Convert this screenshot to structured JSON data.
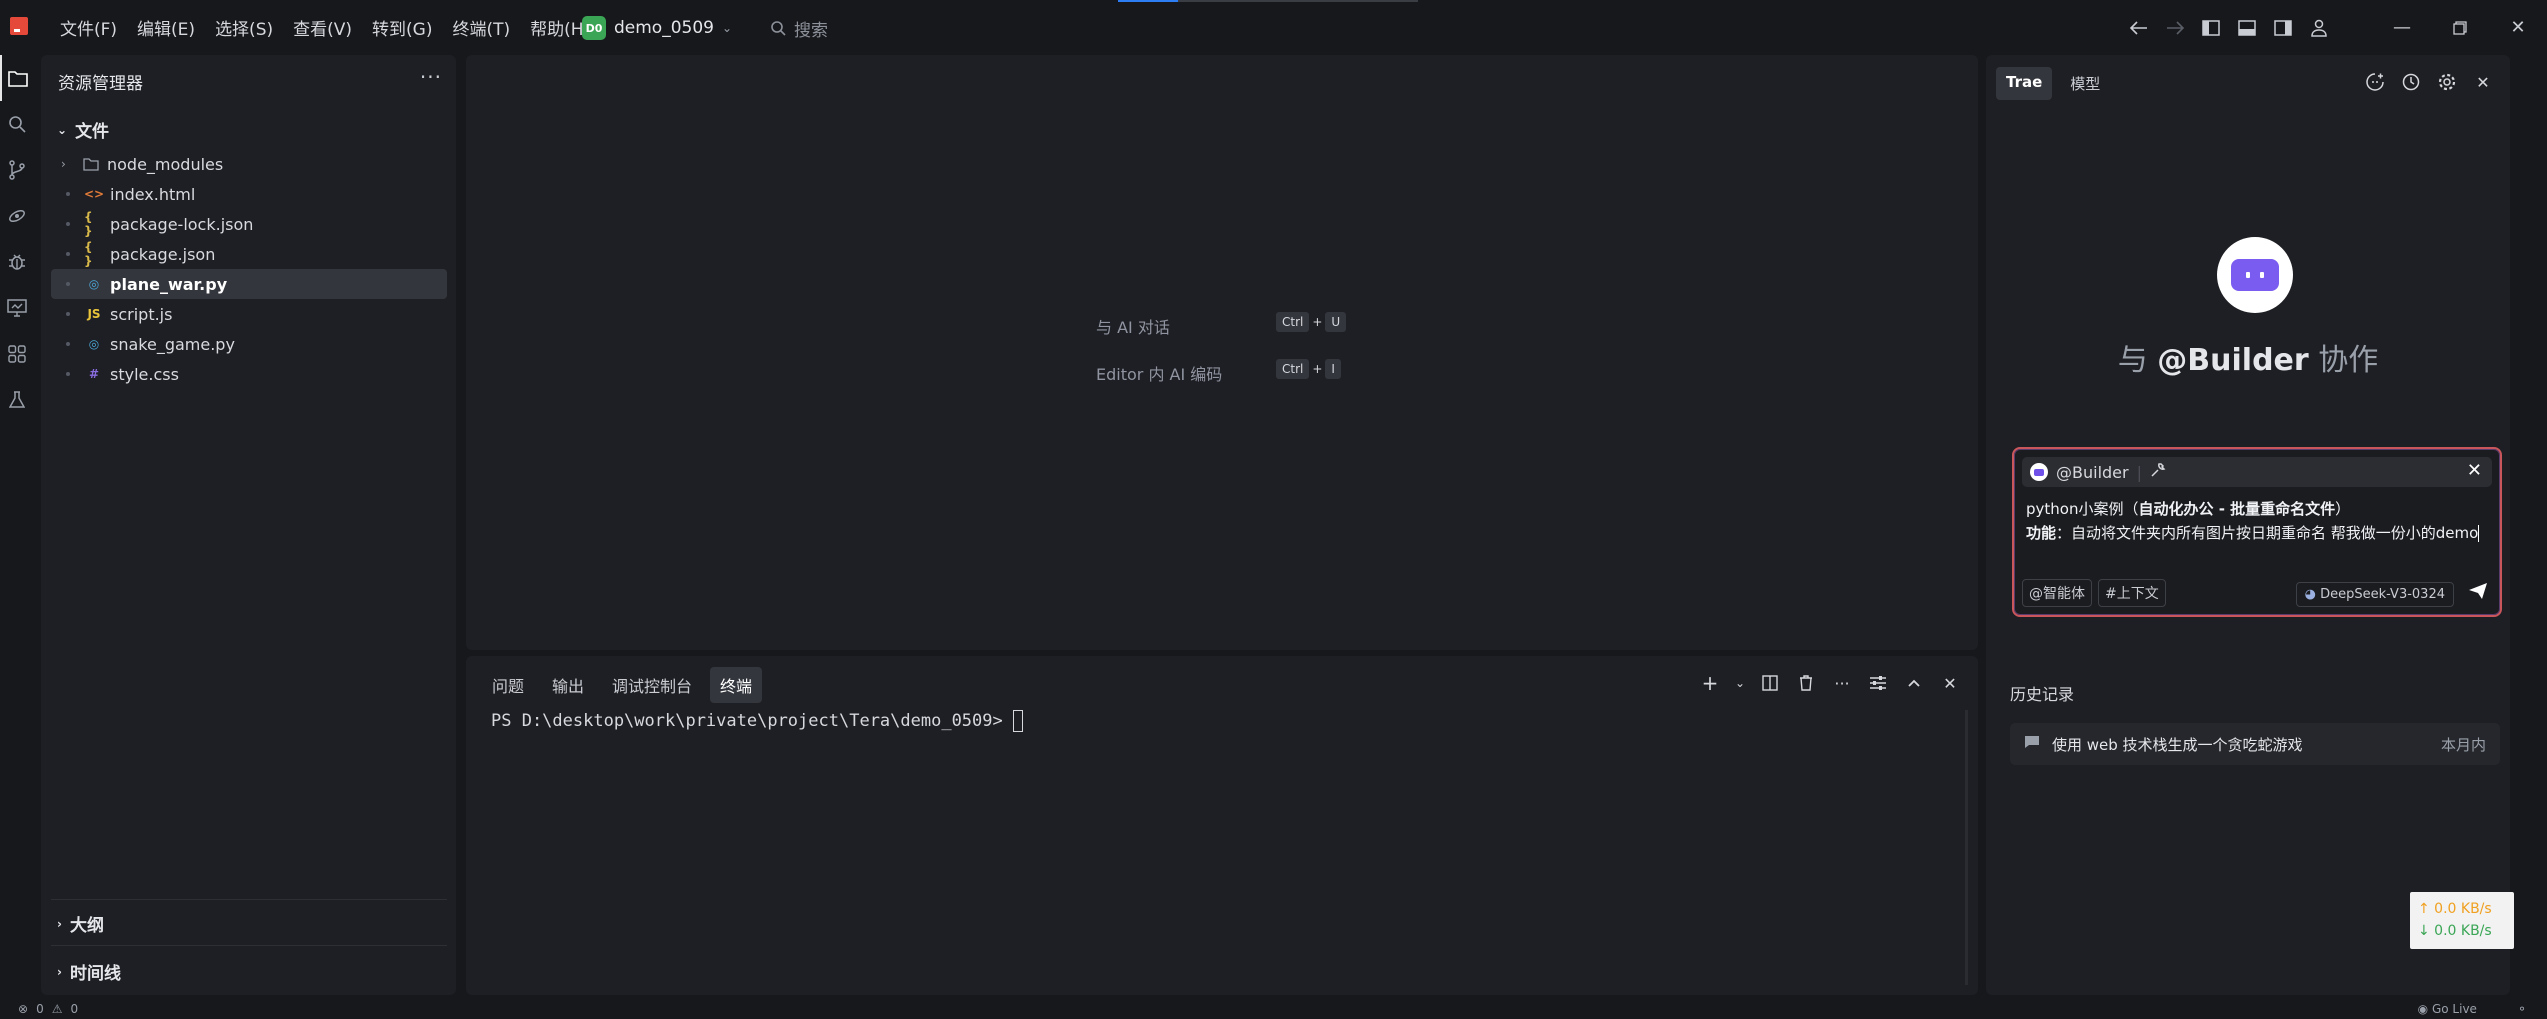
{
  "menu": [
    "文件(F)",
    "编辑(E)",
    "选择(S)",
    "查看(V)",
    "转到(G)",
    "终端(T)",
    "帮助(H)"
  ],
  "project": {
    "badge": "D0",
    "name": "demo_0509"
  },
  "search": {
    "placeholder": "搜索"
  },
  "explorer": {
    "title": "资源管理器",
    "section": "文件",
    "files": [
      {
        "name": "node_modules",
        "type": "folder",
        "icon_color": "#9aa0aa"
      },
      {
        "name": "index.html",
        "type": "html",
        "icon_color": "#e07b39"
      },
      {
        "name": "package-lock.json",
        "type": "json",
        "icon_color": "#d7b84a"
      },
      {
        "name": "package.json",
        "type": "json",
        "icon_color": "#d7b84a"
      },
      {
        "name": "plane_war.py",
        "type": "py",
        "icon_color": "#4aa8d8",
        "selected": true
      },
      {
        "name": "script.js",
        "type": "js",
        "icon_color": "#e8c43a"
      },
      {
        "name": "snake_game.py",
        "type": "py",
        "icon_color": "#4aa8d8"
      },
      {
        "name": "style.css",
        "type": "css",
        "icon_color": "#8a6de0"
      }
    ],
    "outline": "大纲",
    "timeline": "时间线"
  },
  "editor": {
    "hint_chat": "与 AI 对话",
    "hint_chat_keys": [
      "Ctrl",
      "+",
      "U"
    ],
    "hint_code": "Editor 内 AI 编码",
    "hint_code_keys": [
      "Ctrl",
      "+",
      "I"
    ]
  },
  "panel": {
    "tabs": [
      "问题",
      "输出",
      "调试控制台",
      "终端"
    ],
    "active_tab": "终端",
    "prompt": "PS D:\\desktop\\work\\private\\project\\Tera\\demo_0509>"
  },
  "chat": {
    "tabs": [
      "Trae",
      "模型"
    ],
    "collab_prefix": "与",
    "collab_agent": "@Builder",
    "collab_suffix": "协作",
    "agent_tag": "@Builder",
    "input_line1_plain": "python小案例（",
    "input_line1_bold": "自动化办公 - 批量重命名文件",
    "input_line1_end": "）",
    "input_line2_bold": "功能",
    "input_line2_rest": "：自动将文件夹内所有图片按日期重命名 帮我做一份小的demo",
    "chip_agent": "@智能体",
    "chip_context": "#上下文",
    "model": "DeepSeek-V3-0324",
    "history_title": "历史记录",
    "history": [
      {
        "title": "使用 web 技术栈生成一个贪吃蛇游戏",
        "time": "本月内"
      }
    ]
  },
  "network": {
    "up": "↑ 0.0 KB/s",
    "down": "↓ 0.0 KB/s"
  },
  "status": {
    "errors": "0",
    "warnings": "0",
    "golive": "Go Live"
  },
  "colors": {
    "accent": "#2d7df5",
    "brand": "#e5493a",
    "input_border": "#c9565a"
  }
}
